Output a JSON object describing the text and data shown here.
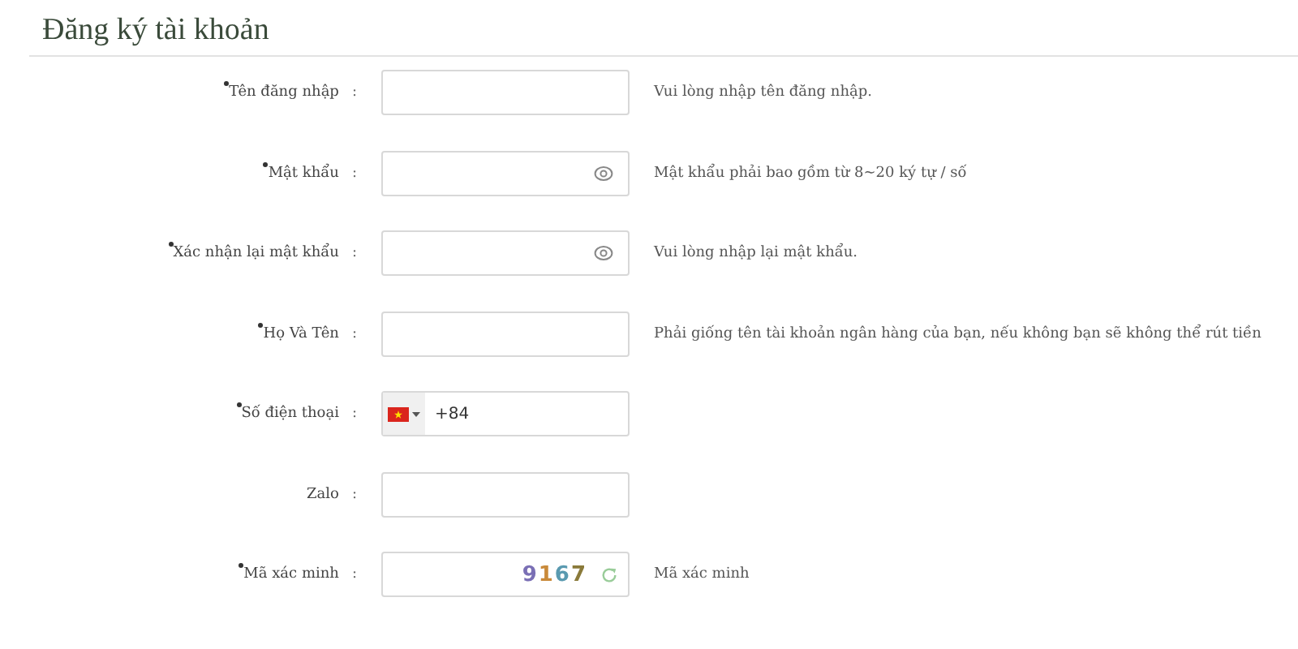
{
  "title": "Đăng ký tài khoản",
  "fields": [
    {
      "kind": "text",
      "label": "Tên đăng nhập",
      "colon": ":",
      "required": true,
      "hint": "Vui lòng nhập tên đăng nhập."
    },
    {
      "kind": "password",
      "label": "Mật khẩu",
      "colon": ":",
      "required": true,
      "hint": "Mật khẩu phải bao gồm từ 8~20 ký tự / số"
    },
    {
      "kind": "password",
      "label": "Xác nhận lại mật khẩu",
      "colon": ":",
      "required": true,
      "hint": "Vui lòng nhập lại mật khẩu."
    },
    {
      "kind": "text",
      "label": "Họ Và Tên",
      "colon": ":",
      "required": true,
      "hint": "Phải giống tên tài khoản ngân hàng của bạn, nếu không bạn sẽ không thể rút tiền"
    },
    {
      "kind": "phone",
      "label": "Số điện thoại",
      "colon": ":",
      "required": true,
      "value": "+84"
    },
    {
      "kind": "text",
      "label": "Zalo",
      "colon": ":",
      "required": false
    },
    {
      "kind": "captcha",
      "label": "Mã xác minh",
      "colon": ":",
      "required": true,
      "captcha": "9167",
      "hint": "Mã xác minh"
    }
  ]
}
